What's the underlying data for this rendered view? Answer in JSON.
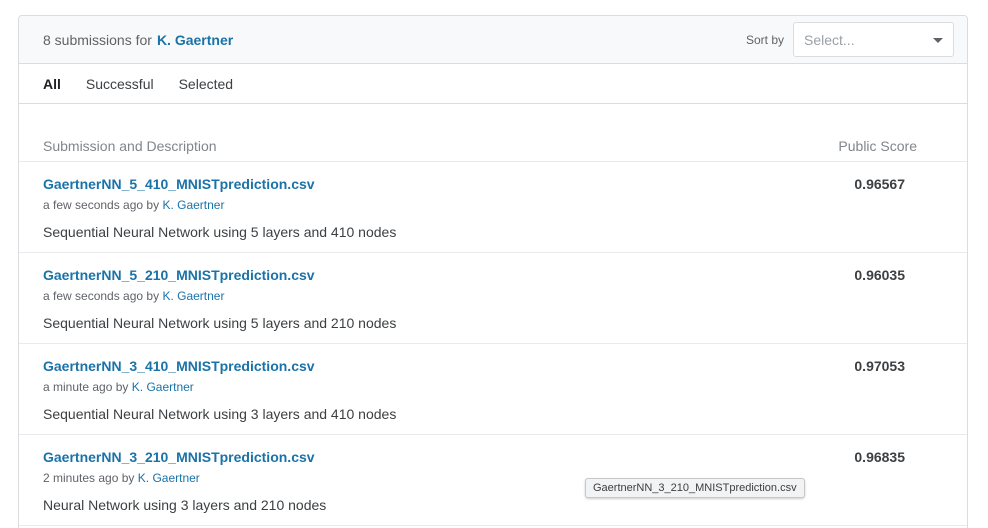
{
  "header": {
    "count_text": "8 submissions for",
    "user_name": "K. Gaertner",
    "sort_label": "Sort by",
    "sort_placeholder": "Select..."
  },
  "tabs": [
    {
      "label": "All",
      "active": true
    },
    {
      "label": "Successful",
      "active": false
    },
    {
      "label": "Selected",
      "active": false
    }
  ],
  "table": {
    "col_description": "Submission and Description",
    "col_score": "Public Score",
    "rows": [
      {
        "file": "GaertnerNN_5_410_MNISTprediction.csv",
        "time": "a few seconds ago",
        "by": "by",
        "user": "K. Gaertner",
        "description": "Sequential Neural Network using 5 layers and 410 nodes",
        "score": "0.96567"
      },
      {
        "file": "GaertnerNN_5_210_MNISTprediction.csv",
        "time": "a few seconds ago",
        "by": "by",
        "user": "K. Gaertner",
        "description": "Sequential Neural Network using 5 layers and 210 nodes",
        "score": "0.96035"
      },
      {
        "file": "GaertnerNN_3_410_MNISTprediction.csv",
        "time": "a minute ago",
        "by": "by",
        "user": "K. Gaertner",
        "description": "Sequential Neural Network using 3 layers and 410 nodes",
        "score": "0.97053"
      },
      {
        "file": "GaertnerNN_3_210_MNISTprediction.csv",
        "time": "2 minutes ago",
        "by": "by",
        "user": "K. Gaertner",
        "description": "Neural Network using 3 layers and 210 nodes",
        "score": "0.96835"
      }
    ]
  },
  "tooltip": {
    "text": "GaertnerNN_3_210_MNISTprediction.csv"
  }
}
